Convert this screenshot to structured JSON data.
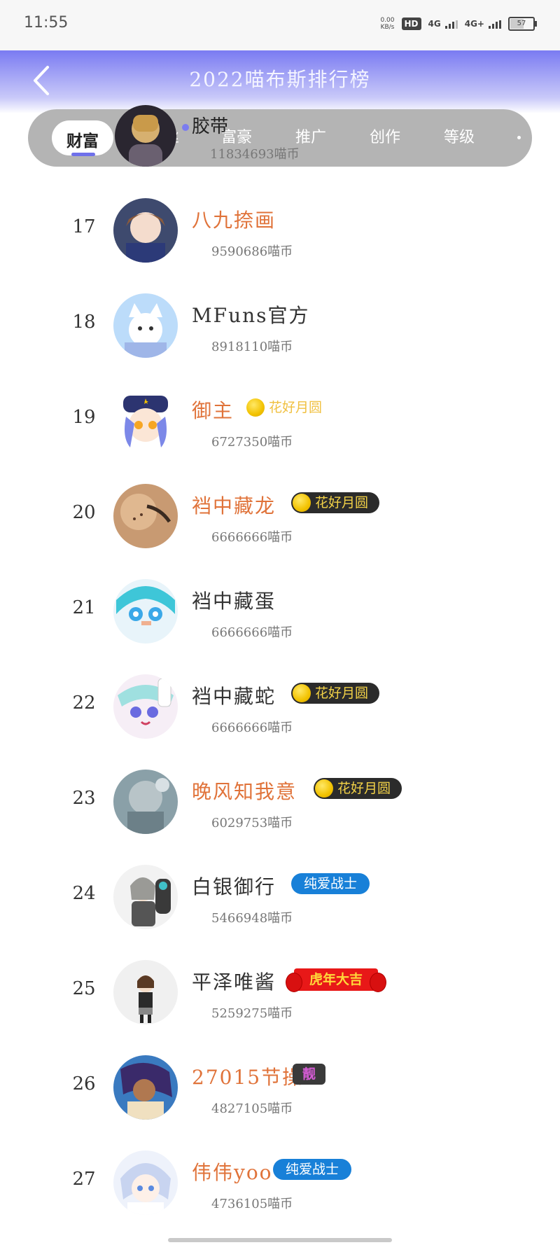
{
  "status_bar": {
    "time": "11:55",
    "net_speed_value": "0.00",
    "net_speed_unit": "KB/s",
    "hd_label": "HD",
    "signal_1": "4G",
    "signal_2": "4G+",
    "battery": "57"
  },
  "header": {
    "title": "2022喵布斯排行榜"
  },
  "tabs": [
    "财富",
    "粉丝",
    "富豪",
    "推广",
    "创作",
    "等级"
  ],
  "active_tab": "财富",
  "overlap_user": {
    "name": "胶带",
    "coins": "11834693喵币"
  },
  "rows": [
    {
      "rank": "17",
      "name": "八九捺画",
      "name_color": "orange",
      "coins": "9590686喵币",
      "badge": null
    },
    {
      "rank": "18",
      "name": "MFuns官方",
      "name_color": "dark",
      "coins": "8918110喵币",
      "badge": null
    },
    {
      "rank": "19",
      "name": "御主",
      "name_color": "orange",
      "coins": "6727350喵币",
      "badge": {
        "type": "moon-light",
        "text": "花好月圆"
      }
    },
    {
      "rank": "20",
      "name": "裆中藏龙",
      "name_color": "orange",
      "coins": "6666666喵币",
      "badge": {
        "type": "moon",
        "text": "花好月圆"
      }
    },
    {
      "rank": "21",
      "name": "裆中藏蛋",
      "name_color": "dark",
      "coins": "6666666喵币",
      "badge": null
    },
    {
      "rank": "22",
      "name": "裆中藏蛇",
      "name_color": "dark",
      "coins": "6666666喵币",
      "badge": {
        "type": "moon",
        "text": "花好月圆"
      }
    },
    {
      "rank": "23",
      "name": "晚风知我意",
      "name_color": "orange",
      "coins": "6029753喵币",
      "badge": {
        "type": "moon",
        "text": "花好月圆"
      }
    },
    {
      "rank": "24",
      "name": "白银御行",
      "name_color": "dark",
      "coins": "5466948喵币",
      "badge": {
        "type": "blue",
        "text": "纯爱战士"
      }
    },
    {
      "rank": "25",
      "name": "平泽唯酱",
      "name_color": "dark",
      "coins": "5259275喵币",
      "badge": {
        "type": "tiger",
        "text": "虎年大吉"
      }
    },
    {
      "rank": "26",
      "name": "27015节操",
      "name_color": "orange",
      "coins": "4827105喵币",
      "badge": {
        "type": "liang",
        "text": "靓"
      }
    },
    {
      "rank": "27",
      "name": "伟伟yoo",
      "name_color": "orange",
      "coins": "4736105喵币",
      "badge": {
        "type": "blue",
        "text": "纯爱战士"
      }
    }
  ],
  "colors": {
    "header_top": "#7a7bf2",
    "accent": "#6f70ea",
    "orange_name": "#e0733a",
    "badge_blue": "#1880d8",
    "badge_red": "#e81818"
  }
}
